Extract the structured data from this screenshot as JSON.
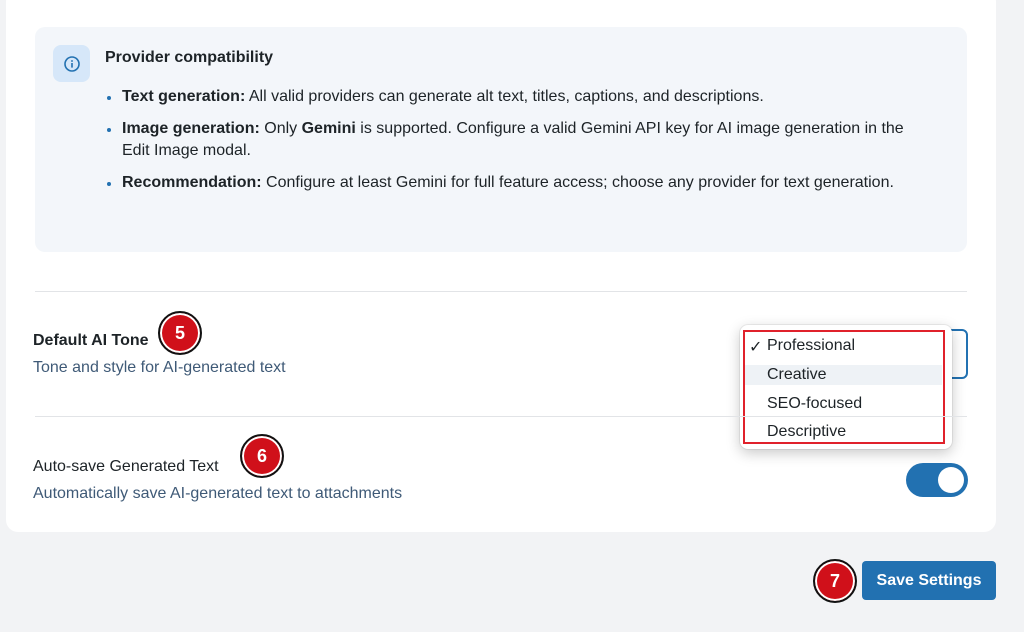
{
  "info_box": {
    "title": "Provider compatibility",
    "bullets": [
      {
        "label": "Text generation:",
        "text_before": " All valid providers can generate alt text, titles, captions, and descriptions.",
        "bold_word": "",
        "text_after": ""
      },
      {
        "label": "Image generation:",
        "text_before": " Only ",
        "bold_word": "Gemini",
        "text_after": " is supported. Configure a valid Gemini API key for AI image generation in the Edit Image modal."
      },
      {
        "label": "Recommendation:",
        "text_before": " Configure at least Gemini for full feature access; choose any provider for text generation.",
        "bold_word": "",
        "text_after": ""
      }
    ]
  },
  "tone": {
    "title": "Default AI Tone",
    "description": "Tone and style for AI-generated text",
    "options": [
      "Professional",
      "Creative",
      "SEO-focused",
      "Descriptive"
    ],
    "check_glyph": "✓",
    "badge": "5"
  },
  "autosave": {
    "title": "Auto-save Generated Text",
    "description": "Automatically save AI-generated text to attachments",
    "enabled": true,
    "badge": "6"
  },
  "footer": {
    "save_label": "Save Settings",
    "badge": "7"
  },
  "colors": {
    "accent": "#2271b1",
    "annotation_red": "#d0101a",
    "info_bg": "#f3f6fa"
  },
  "icons": {
    "info": "info-circle-icon",
    "check": "checkmark-icon"
  }
}
